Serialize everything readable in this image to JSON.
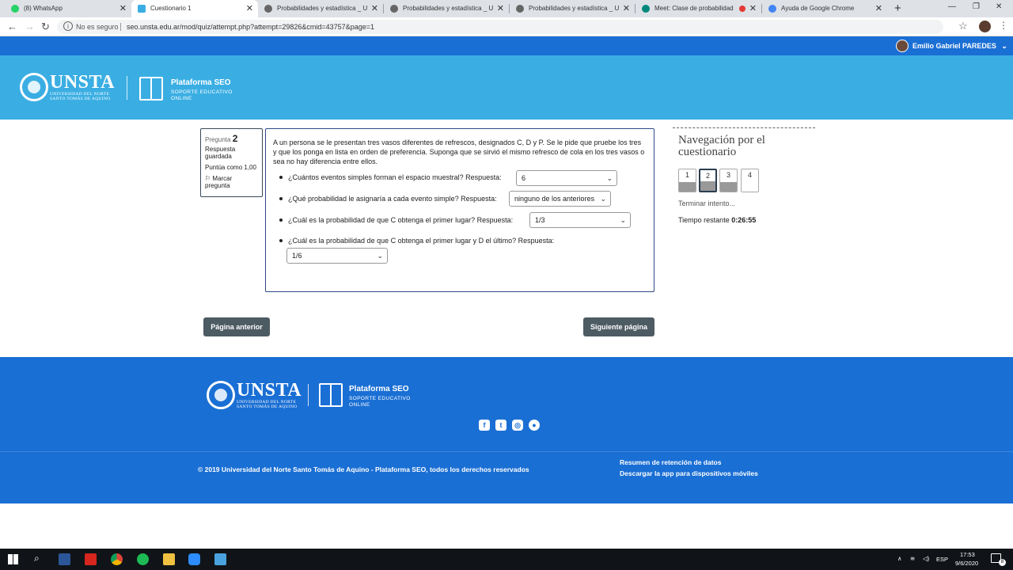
{
  "browser": {
    "tabs": [
      {
        "label": "(8) WhatsApp",
        "favicon_color": "#25d366"
      },
      {
        "label": "Cuestionario 1",
        "favicon_color": "#3aaee3"
      },
      {
        "label": "Probabilidades y estadística _ U",
        "favicon_color": "#666666"
      },
      {
        "label": "Probabilidades y estadística _ U",
        "favicon_color": "#666666"
      },
      {
        "label": "Probabilidades y estadística _ U",
        "favicon_color": "#666666"
      },
      {
        "label": "Meet: Clase de probabilidad",
        "favicon_color": "#00897b"
      },
      {
        "label": "Ayuda de Google Chrome",
        "favicon_color": "#4285f4"
      }
    ],
    "new_tab": "+",
    "address": {
      "security_label": "No es seguro",
      "url": "seo.unsta.edu.ar/mod/quiz/attempt.php?attempt=29826&cmid=43757&page=1"
    },
    "window_controls": {
      "minimize": "—",
      "maximize": "❐",
      "close": "✕"
    }
  },
  "user": {
    "name": "Emilio Gabriel PAREDES",
    "caret": "⌄"
  },
  "header": {
    "logo_text": "UNSTA",
    "logo_sub_1": "UNIVERSIDAD DEL NORTE",
    "logo_sub_2": "SANTO TOMÁS DE AQUINO",
    "platform_title": "Plataforma SEO",
    "platform_sub_1": "SOPORTE EDUCATIVO",
    "platform_sub_2": "ONLINE"
  },
  "question_info": {
    "label": "Pregunta",
    "number": "2",
    "state": "Respuesta guardada",
    "grade": "Puntúa como 1,00",
    "flag_label": "Marcar pregunta"
  },
  "question": {
    "text": "A un persona se le presentan tres vasos diferentes de refrescos, designados C, D y P. Se le pide que pruebe los tres y que los ponga en lista en orden de preferencia. Suponga que se sirvió el mismo refresco de cola en los tres vasos o sea no hay diferencia entre ellos.",
    "subquestions": [
      {
        "prompt": "¿Cuántos eventos simples forman el espacio muestral? Respuesta:",
        "answer": "6"
      },
      {
        "prompt": "¿Qué probabilidad le asignaría a cada evento simple? Respuesta:",
        "answer": "ninguno de los anteriores"
      },
      {
        "prompt": "¿Cuál es la probabilidad de que C obtenga el primer lugar? Respuesta:",
        "answer": "1/3"
      },
      {
        "prompt": "¿Cuál es la probabilidad de que C obtenga el primer lugar y D el último? Respuesta:",
        "answer": "1/6"
      }
    ]
  },
  "buttons": {
    "previous": "Página anterior",
    "next": "Siguiente página"
  },
  "quiz_nav": {
    "title": "Navegación por el cuestionario",
    "questions": [
      {
        "num": "1",
        "answered": true,
        "current": false
      },
      {
        "num": "2",
        "answered": true,
        "current": true
      },
      {
        "num": "3",
        "answered": true,
        "current": false
      },
      {
        "num": "4",
        "answered": false,
        "current": false
      }
    ],
    "finish": "Terminar intento...",
    "timer_label": "Tiempo restante",
    "timer_value": "0:26:55"
  },
  "footer": {
    "copyright": "© 2019 Universidad del Norte Santo Tomás de Aquino - Plataforma SEO, todos los derechos reservados",
    "link_1": "Resumen de retención de datos",
    "link_2": "Descargar la app para dispositivos móviles"
  },
  "taskbar": {
    "language": "ESP",
    "time": "17:53",
    "date": "9/6/2020",
    "notifications": "8"
  }
}
